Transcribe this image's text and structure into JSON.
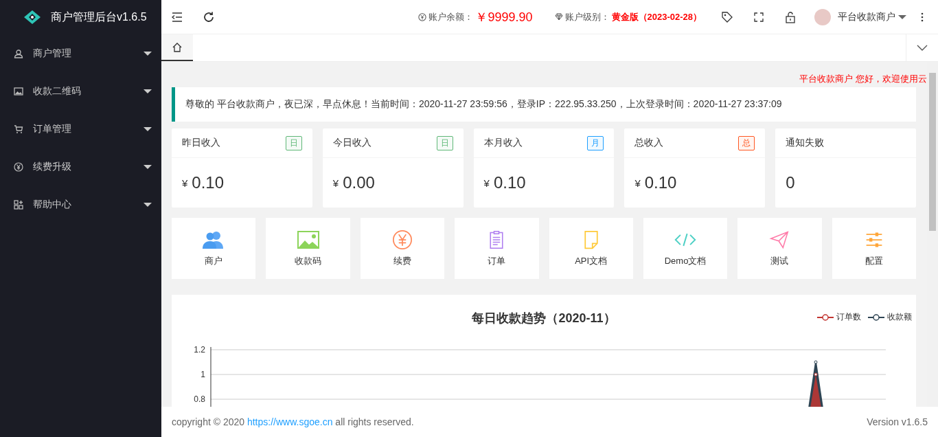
{
  "sidebar": {
    "logo_text": "商户管理后台v1.6.5",
    "items": [
      {
        "label": "商户管理"
      },
      {
        "label": "收款二维码"
      },
      {
        "label": "订单管理"
      },
      {
        "label": "续费升级"
      },
      {
        "label": "帮助中心"
      }
    ]
  },
  "header": {
    "balance_label": "账户余额：",
    "balance": "￥9999.90",
    "level_label": "账户级别：",
    "level": "黄金版（2023-02-28）",
    "user": "平台收款商户"
  },
  "tabs": [
    {
      "selected": true
    }
  ],
  "marquee": "平台收款商户 您好，欢迎使用云",
  "notice": "尊敬的 平台收款商户，夜已深，早点休息！当前时间：2020-11-27 23:59:56，登录IP：222.95.33.250，上次登录时间：2020-11-27 23:37:09",
  "stats": [
    {
      "title": "昨日收入",
      "badge": "日",
      "color": "#5fb878",
      "currency": "¥",
      "value": "0.10"
    },
    {
      "title": "今日收入",
      "badge": "日",
      "color": "#5fb878",
      "currency": "¥",
      "value": "0.00"
    },
    {
      "title": "本月收入",
      "badge": "月",
      "color": "#1e9fff",
      "currency": "¥",
      "value": "0.10"
    },
    {
      "title": "总收入",
      "badge": "总",
      "color": "#ff5722",
      "currency": "¥",
      "value": "0.10"
    },
    {
      "title": "通知失败",
      "value": "0"
    }
  ],
  "shortcuts": [
    {
      "label": "商户"
    },
    {
      "label": "收款码"
    },
    {
      "label": "续费"
    },
    {
      "label": "订单"
    },
    {
      "label": "API文档"
    },
    {
      "label": "Demo文档"
    },
    {
      "label": "测试"
    },
    {
      "label": "配置"
    }
  ],
  "chart": {
    "title": "每日收款趋势（2020-11）",
    "legend": [
      {
        "name": "订单数",
        "color": "#c23531"
      },
      {
        "name": "收款额",
        "color": "#2f4554"
      }
    ],
    "y_ticks": [
      "1.2",
      "1",
      "0.8"
    ]
  },
  "footer": {
    "copyright": "copyright © 2020",
    "link": "https://www.sgoe.cn",
    "rights": "all rights reserved.",
    "version": "Version v1.6.5"
  }
}
